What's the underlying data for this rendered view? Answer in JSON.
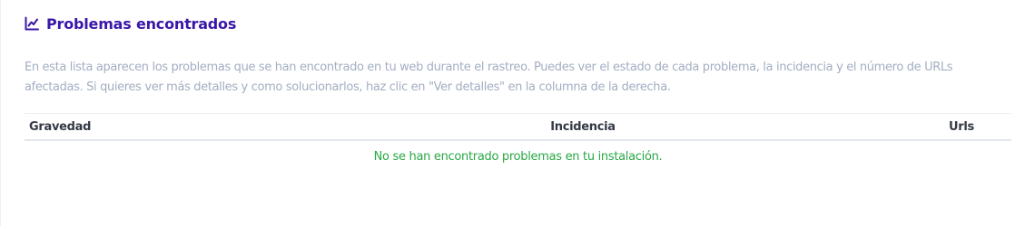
{
  "section": {
    "title": "Problemas encontrados",
    "title_icon": "line-chart-icon",
    "description": "En esta lista aparecen los problemas que se han encontrado en tu web durante el rastreo. Puedes ver el estado de cada problema, la incidencia y el número de URLs afectadas. Si quieres ver más detalles y como solucionarlos, haz clic en \"Ver detalles\" en la columna de la derecha."
  },
  "table": {
    "columns": [
      "Gravedad",
      "Incidencia",
      "Urls"
    ],
    "empty_message": "No se han encontrado problemas en tu instalación."
  },
  "colors": {
    "title": "#3b17a8",
    "description": "#a3aec2",
    "header_text": "#343a45",
    "success": "#29a846"
  }
}
